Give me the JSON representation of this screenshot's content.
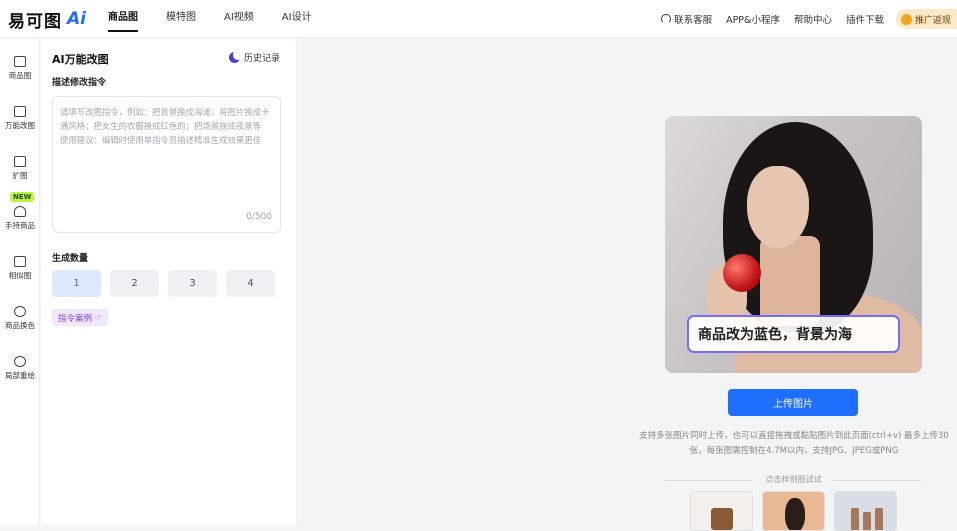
{
  "header": {
    "logo_text": "易可图",
    "logo_ai": "Ai",
    "tabs": [
      {
        "label": "商品图",
        "active": true
      },
      {
        "label": "模特图",
        "active": false
      },
      {
        "label": "AI视频",
        "active": false
      },
      {
        "label": "AI设计",
        "active": false
      }
    ],
    "right_links": {
      "support": "联系客服",
      "app": "APP&小程序",
      "help": "帮助中心",
      "plugin": "插件下载",
      "promo": "推广返现"
    }
  },
  "sidebar": {
    "items": [
      {
        "label": "商品图",
        "icon": "bag-icon",
        "active": false
      },
      {
        "label": "万能改图",
        "icon": "edit-image-icon",
        "active": true
      },
      {
        "label": "扩图",
        "icon": "expand-ai-icon",
        "active": false
      },
      {
        "label": "手持商品",
        "icon": "hand-hold-icon",
        "active": false
      },
      {
        "label": "相似图",
        "icon": "similar-image-icon",
        "active": false
      },
      {
        "label": "商品换色",
        "icon": "color-drop-icon",
        "active": false
      },
      {
        "label": "局部重绘",
        "icon": "face-icon",
        "active": false
      }
    ],
    "new_badge": "NEW"
  },
  "panel": {
    "title": "AI万能改图",
    "history": "历史记录",
    "prompt_label": "描述修改指令",
    "prompt_placeholder": "请填写改图指令，例如：把背景换成海滩；将图片换成卡通风格；把女生的衣服换成红色的；把场景换成夜景等\n使用建议：编辑时使用单指令且描述精准生成效果更佳",
    "counter": "0/500",
    "quantity_label": "生成数量",
    "quantities": [
      "1",
      "2",
      "3",
      "4"
    ],
    "selected_quantity": "1",
    "examples_button": "指令案例"
  },
  "main": {
    "preview_caption": "商品改为蓝色，背景为海",
    "upload_button": "上传图片",
    "hint": "支持多张图片同时上传，也可以直接拖拽或黏贴图片到此页面(ctrl+v) 最多上传30张，每张图需控制在4.7M以内，支持JPG、JPEG或PNG",
    "samples_label": "点击样例图试试",
    "accent_color": "#1f6fff"
  }
}
